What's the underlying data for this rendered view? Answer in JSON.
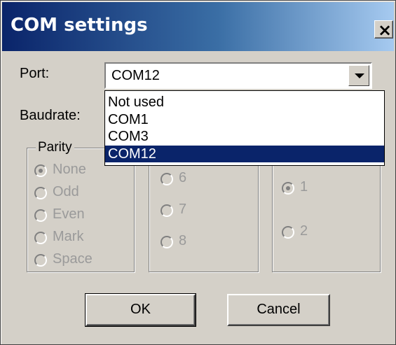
{
  "window": {
    "title": "COM settings",
    "close_glyph": "×"
  },
  "port": {
    "label": "Port:",
    "value": "COM12",
    "options": [
      "Not used",
      "COM1",
      "COM3",
      "COM12"
    ],
    "selected_index": 3
  },
  "baudrate": {
    "label": "Baudrate:"
  },
  "parity": {
    "legend": "Parity",
    "options": [
      "None",
      "Odd",
      "Even",
      "Mark",
      "Space"
    ],
    "selected": "None"
  },
  "databits": {
    "options": [
      "6",
      "7",
      "8"
    ]
  },
  "stopbits": {
    "options": [
      "1",
      "2"
    ],
    "selected": "1"
  },
  "buttons": {
    "ok": "OK",
    "cancel": "Cancel"
  },
  "colors": {
    "title_bar_start": "#0a246a",
    "title_bar_end": "#a6caf0",
    "dialog_face": "#d4d0c8",
    "selection": "#0a246a",
    "disabled_text": "#9a9a9a"
  }
}
